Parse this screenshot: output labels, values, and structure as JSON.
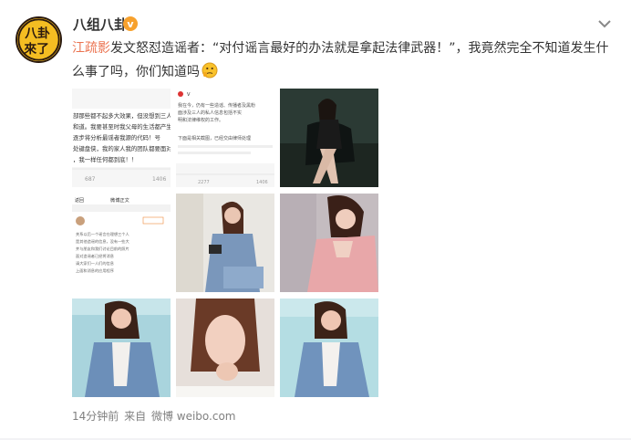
{
  "post": {
    "username": "八组八卦",
    "verified_icon": "v",
    "mention": "江疏影",
    "text_part1": "发文怒怼造谣者：“对付谣言最好的办法就是拿起法律武器！”，我竟然完全不知道发生什么事了吗，你们知道吗",
    "emoji_name": "thinking-face-icon",
    "time": "14分钟前",
    "from_label": "来自",
    "source": "微博 weibo.com",
    "avatar_text": [
      "八卦",
      "來了"
    ]
  },
  "thumbnails": {
    "t1": {
      "lines": [
        "部那些都不起多大效果，但没想到三人",
        "和道。我要甚至时我父母的生活都产生",
        "逐步将分析最谣者我源的代码！号",
        "处键盘侠，我的家人我的团队都要面对",
        "，我一样任何都到底！！"
      ],
      "stats": [
        "687",
        "1406"
      ]
    },
    "t2": {
      "lines": [
        "我在今，仍有一些造谣、传播者及黑粉",
        "面涉及三人的私人信息包括不实",
        "明和法律维权的工作。",
        "下面是相关截图，已经交由律师处理"
      ],
      "stats": [
        "2277",
        "1406"
      ]
    },
    "t4": {
      "title": "微博正文",
      "back": "返回",
      "lines": [
        "关系以后一个谣言在理想三个人",
        "是其他造谣的信息，没有一些大",
        "并与朋友和我们讨论目前的照片",
        "面对造谣者已经将消息",
        "请大家们一人们的信息",
        "上面和消息的应用程序"
      ]
    }
  },
  "colors": {
    "mention": "#eb7350",
    "meta": "#808080",
    "verified": "#f7a12d",
    "avatar_bg": "#f2b81d"
  }
}
